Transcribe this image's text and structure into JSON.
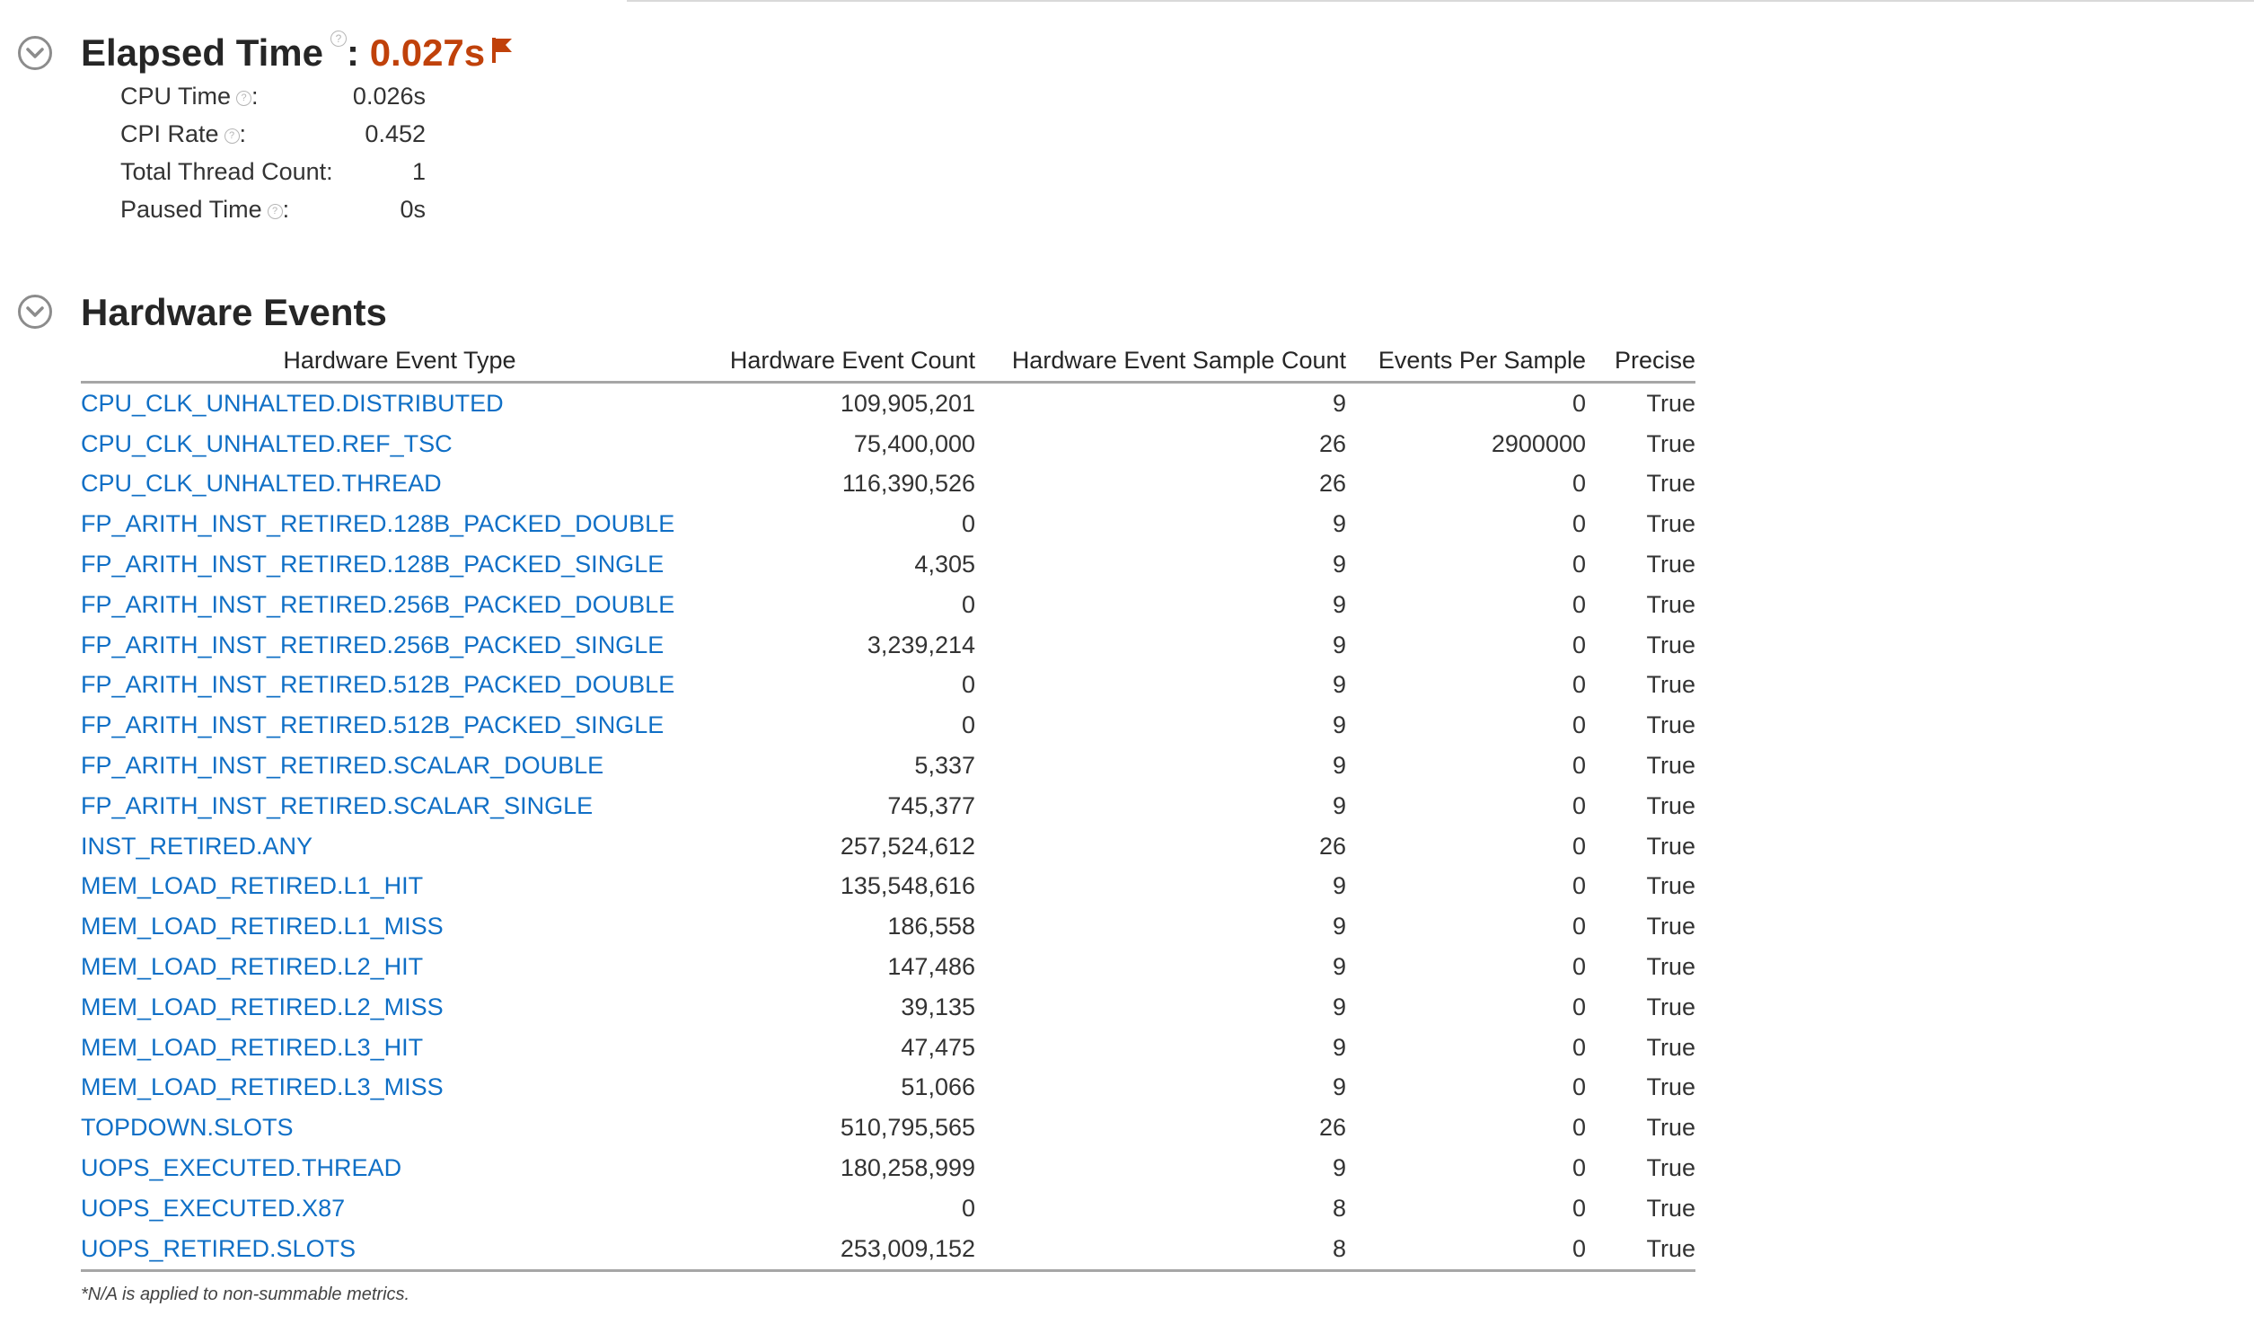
{
  "elapsed": {
    "title": "Elapsed Time",
    "help": "?",
    "separator": ":",
    "value": "0.027s",
    "flag_icon": "flag-icon",
    "accent_color": "#c0410a",
    "metrics": [
      {
        "label": "CPU Time",
        "help": "?",
        "suffix": ":",
        "value": "0.026s"
      },
      {
        "label": "CPI Rate",
        "help": "?",
        "suffix": ":",
        "value": "0.452"
      },
      {
        "label": "Total Thread Count:",
        "help": "",
        "suffix": "",
        "value": "1"
      },
      {
        "label": "Paused Time",
        "help": "?",
        "suffix": ":",
        "value": "0s"
      }
    ]
  },
  "hardware": {
    "title": "Hardware Events",
    "link_color": "#0f6fc6",
    "columns": [
      "Hardware Event Type",
      "Hardware Event Count",
      "Hardware Event Sample Count",
      "Events Per Sample",
      "Precise"
    ],
    "rows": [
      [
        "CPU_CLK_UNHALTED.DISTRIBUTED",
        "109,905,201",
        "9",
        "0",
        "True"
      ],
      [
        "CPU_CLK_UNHALTED.REF_TSC",
        "75,400,000",
        "26",
        "2900000",
        "True"
      ],
      [
        "CPU_CLK_UNHALTED.THREAD",
        "116,390,526",
        "26",
        "0",
        "True"
      ],
      [
        "FP_ARITH_INST_RETIRED.128B_PACKED_DOUBLE",
        "0",
        "9",
        "0",
        "True"
      ],
      [
        "FP_ARITH_INST_RETIRED.128B_PACKED_SINGLE",
        "4,305",
        "9",
        "0",
        "True"
      ],
      [
        "FP_ARITH_INST_RETIRED.256B_PACKED_DOUBLE",
        "0",
        "9",
        "0",
        "True"
      ],
      [
        "FP_ARITH_INST_RETIRED.256B_PACKED_SINGLE",
        "3,239,214",
        "9",
        "0",
        "True"
      ],
      [
        "FP_ARITH_INST_RETIRED.512B_PACKED_DOUBLE",
        "0",
        "9",
        "0",
        "True"
      ],
      [
        "FP_ARITH_INST_RETIRED.512B_PACKED_SINGLE",
        "0",
        "9",
        "0",
        "True"
      ],
      [
        "FP_ARITH_INST_RETIRED.SCALAR_DOUBLE",
        "5,337",
        "9",
        "0",
        "True"
      ],
      [
        "FP_ARITH_INST_RETIRED.SCALAR_SINGLE",
        "745,377",
        "9",
        "0",
        "True"
      ],
      [
        "INST_RETIRED.ANY",
        "257,524,612",
        "26",
        "0",
        "True"
      ],
      [
        "MEM_LOAD_RETIRED.L1_HIT",
        "135,548,616",
        "9",
        "0",
        "True"
      ],
      [
        "MEM_LOAD_RETIRED.L1_MISS",
        "186,558",
        "9",
        "0",
        "True"
      ],
      [
        "MEM_LOAD_RETIRED.L2_HIT",
        "147,486",
        "9",
        "0",
        "True"
      ],
      [
        "MEM_LOAD_RETIRED.L2_MISS",
        "39,135",
        "9",
        "0",
        "True"
      ],
      [
        "MEM_LOAD_RETIRED.L3_HIT",
        "47,475",
        "9",
        "0",
        "True"
      ],
      [
        "MEM_LOAD_RETIRED.L3_MISS",
        "51,066",
        "9",
        "0",
        "True"
      ],
      [
        "TOPDOWN.SLOTS",
        "510,795,565",
        "26",
        "0",
        "True"
      ],
      [
        "UOPS_EXECUTED.THREAD",
        "180,258,999",
        "9",
        "0",
        "True"
      ],
      [
        "UOPS_EXECUTED.X87",
        "0",
        "8",
        "0",
        "True"
      ],
      [
        "UOPS_RETIRED.SLOTS",
        "253,009,152",
        "8",
        "0",
        "True"
      ]
    ],
    "footnote": "*N/A is applied to non-summable metrics."
  },
  "icons": {
    "collapse": "chevron-down-circle-icon",
    "help": "help-icon",
    "flag": "flag-icon"
  }
}
